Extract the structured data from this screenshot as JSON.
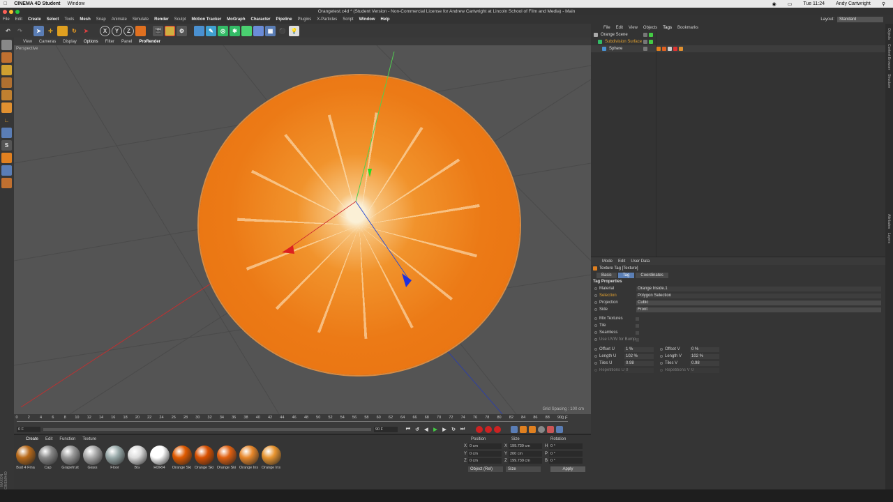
{
  "mac_menu": {
    "app": "CINEMA 4D Student",
    "items": [
      "Window"
    ],
    "clock": "Tue 11:24",
    "user": "Andy Cartwright"
  },
  "window_title": "Orangetest.c4d * (Student Version - Non-Commercial License for Andrew Cartwright at Lincoln School of Film and Media) - Main",
  "menubar": [
    "File",
    "Edit",
    "Create",
    "Select",
    "Tools",
    "Mesh",
    "Snap",
    "Animate",
    "Simulate",
    "Render",
    "Sculpt",
    "Motion Tracker",
    "MoGraph",
    "Character",
    "Pipeline",
    "Plugins",
    "X-Particles",
    "Script",
    "Window",
    "Help"
  ],
  "layout": {
    "label": "Layout:",
    "value": "Standard"
  },
  "toolbar": {
    "x": "X",
    "y": "Y",
    "z": "Z"
  },
  "viewport": {
    "menu": [
      "View",
      "Cameras",
      "Display",
      "Options",
      "Filter",
      "Panel",
      "ProRender"
    ],
    "label": "Perspective",
    "grid_spacing": "Grid Spacing : 100 cm"
  },
  "timeline": {
    "ticks": [
      "0",
      "2",
      "4",
      "6",
      "8",
      "10",
      "12",
      "14",
      "16",
      "18",
      "20",
      "22",
      "24",
      "26",
      "28",
      "30",
      "32",
      "34",
      "36",
      "38",
      "40",
      "42",
      "44",
      "46",
      "48",
      "50",
      "52",
      "54",
      "56",
      "58",
      "60",
      "62",
      "64",
      "66",
      "68",
      "70",
      "72",
      "74",
      "76",
      "78",
      "80",
      "82",
      "84",
      "86",
      "88",
      "90"
    ],
    "end_frame": "0 F",
    "start_field": "0 F",
    "end_field": "90 F",
    "range_left": "0 F"
  },
  "material_manager": {
    "menu": [
      "Create",
      "Edit",
      "Function",
      "Texture"
    ],
    "materials": [
      {
        "label": "Bud 4 Fina",
        "color": "#b86a1a"
      },
      {
        "label": "Cap",
        "color": "#888"
      },
      {
        "label": "Grapefruit",
        "color": "#999"
      },
      {
        "label": "Glass",
        "color": "#aaa"
      },
      {
        "label": "Floor",
        "color": "#9aa"
      },
      {
        "label": "BG",
        "color": "#ddd"
      },
      {
        "label": "HDRI4",
        "color": "#fff"
      },
      {
        "label": "Orange Ski",
        "color": "#e05a00"
      },
      {
        "label": "Orange Ski",
        "color": "#d95000"
      },
      {
        "label": "Orange Ski",
        "color": "#e06010"
      },
      {
        "label": "Orange Ins",
        "color": "#e8872a"
      },
      {
        "label": "Orange Ins",
        "color": "#e89530"
      }
    ]
  },
  "coordinates": {
    "headers": [
      "Position",
      "Size",
      "Rotation"
    ],
    "rows": [
      {
        "pa": "X",
        "pv": "0 cm",
        "sa": "X",
        "sv": "199.739 cm",
        "ra": "H",
        "rv": "0 °"
      },
      {
        "pa": "Y",
        "pv": "0 cm",
        "sa": "Y",
        "sv": "200 cm",
        "ra": "P",
        "rv": "0 °"
      },
      {
        "pa": "Z",
        "pv": "0 cm",
        "sa": "Z",
        "sv": "199.739 cm",
        "ra": "B",
        "rv": "0 °"
      }
    ],
    "mode": "Object (Rel)",
    "size_mode": "Size",
    "apply": "Apply"
  },
  "object_manager": {
    "menu": [
      "File",
      "Edit",
      "View",
      "Objects",
      "Tags",
      "Bookmarks"
    ],
    "objects": [
      {
        "name": "Orange Scene",
        "color": "#ddd"
      },
      {
        "name": "Subdivision Surface",
        "color": "#e0a030"
      },
      {
        "name": "Sphere",
        "color": "#ddd"
      }
    ]
  },
  "side_tabs": [
    "Objects",
    "Content Browser",
    "Structure",
    "Attributes",
    "Layers"
  ],
  "attributes": {
    "menu": [
      "Mode",
      "Edit",
      "User Data"
    ],
    "title": "Texture Tag [Texture]",
    "tabs": [
      "Basic",
      "Tag",
      "Coordinates"
    ],
    "section": "Tag Properties",
    "props": [
      {
        "label": "Material",
        "value": "Orange Inside.1"
      },
      {
        "label": "Selection",
        "value": "Polygon Selection"
      },
      {
        "label": "Projection",
        "value": "Cubic"
      },
      {
        "label": "Side",
        "value": "Front"
      }
    ],
    "checks": [
      "Mix Textures",
      "Tile",
      "Seamless",
      "Use UVW for Bump"
    ],
    "offset_u": {
      "label": "Offset U",
      "value": "1 %"
    },
    "offset_v": {
      "label": "Offset V",
      "value": "0 %"
    },
    "length_u": {
      "label": "Length U",
      "value": "102 %"
    },
    "length_v": {
      "label": "Length V",
      "value": "102 %"
    },
    "tiles_u": {
      "label": "Tiles U",
      "value": "0.98"
    },
    "tiles_v": {
      "label": "Tiles V",
      "value": "0.98"
    },
    "rep_u": {
      "label": "Repetitions U",
      "value": "0"
    },
    "rep_v": {
      "label": "Repetitions V",
      "value": "0"
    }
  }
}
